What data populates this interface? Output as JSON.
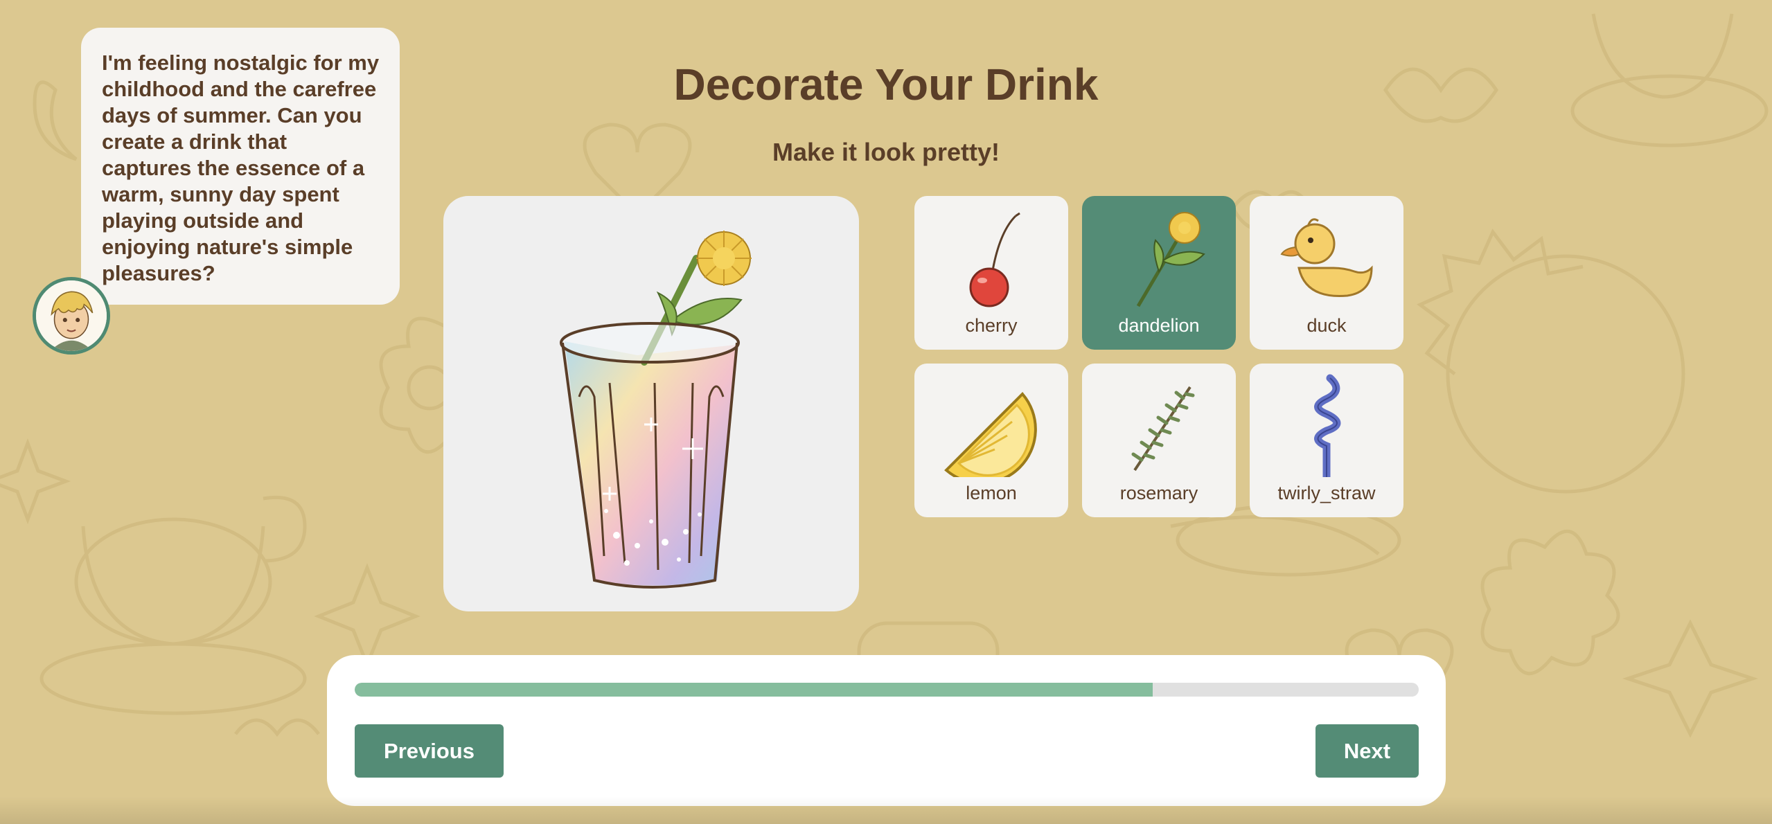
{
  "speech": {
    "text": "I'm feeling nostalgic for my childhood and the carefree days of summer. Can you create a drink that captures the essence of a warm, sunny day spent playing outside and enjoying nature's simple pleasures?"
  },
  "header": {
    "title": "Decorate Your Drink",
    "subtitle": "Make it look pretty!"
  },
  "options": [
    {
      "label": "cherry",
      "icon": "cherry-icon",
      "selected": false
    },
    {
      "label": "dandelion",
      "icon": "dandelion-icon",
      "selected": true
    },
    {
      "label": "duck",
      "icon": "duck-icon",
      "selected": false
    },
    {
      "label": "lemon",
      "icon": "lemon-icon",
      "selected": false
    },
    {
      "label": "rosemary",
      "icon": "rosemary-icon",
      "selected": false
    },
    {
      "label": "twirly_straw",
      "icon": "twirly-straw-icon",
      "selected": false
    }
  ],
  "progress": {
    "fraction": 0.75
  },
  "nav": {
    "previous_label": "Previous",
    "next_label": "Next"
  },
  "colors": {
    "background": "#dcc890",
    "accent": "#548c76",
    "progress": "#85bd9d",
    "text": "#5a3e28"
  }
}
